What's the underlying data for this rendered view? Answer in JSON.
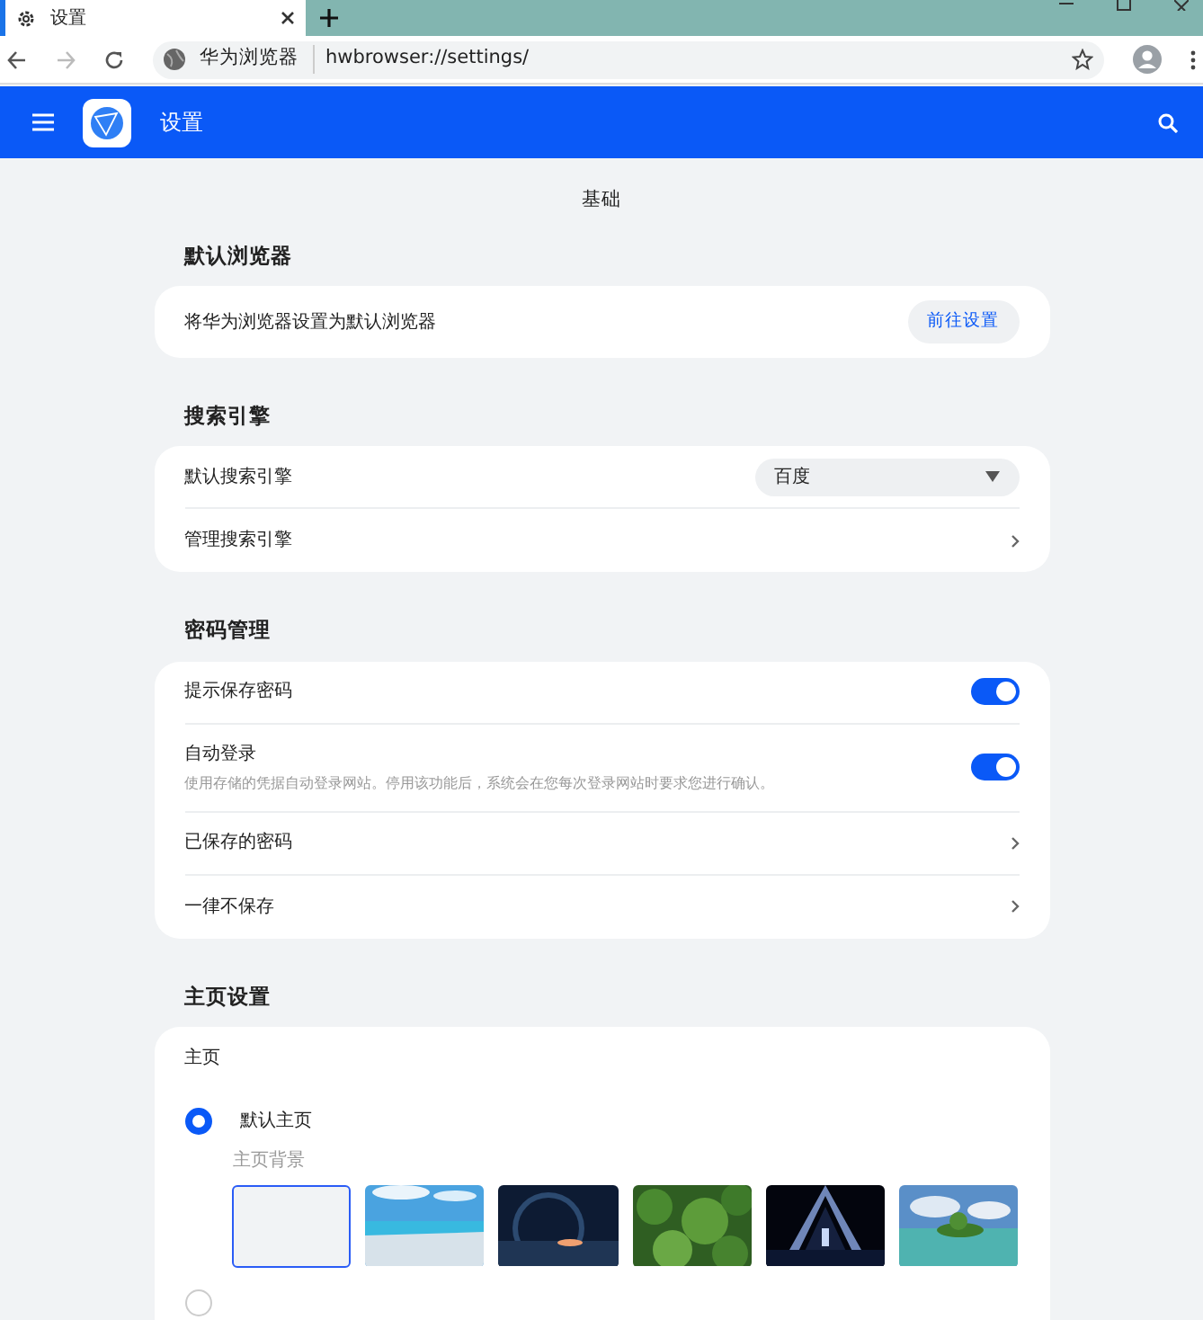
{
  "browser": {
    "tab": {
      "title": "设置"
    },
    "address": {
      "site_label": "华为浏览器",
      "url": "hwbrowser://settings/"
    }
  },
  "header": {
    "title": "设置"
  },
  "page_title": "基础",
  "sections": [
    {
      "title": "默认浏览器",
      "rows": [
        {
          "kind": "button",
          "label": "将华为浏览器设置为默认浏览器",
          "button": "前往设置"
        }
      ]
    },
    {
      "title": "搜索引擎",
      "rows": [
        {
          "kind": "select",
          "label": "默认搜索引擎",
          "value": "百度"
        },
        {
          "kind": "link",
          "label": "管理搜索引擎"
        }
      ]
    },
    {
      "title": "密码管理",
      "rows": [
        {
          "kind": "toggle",
          "label": "提示保存密码",
          "on": true
        },
        {
          "kind": "toggle",
          "label": "自动登录",
          "description": "使用存储的凭据自动登录网站。停用该功能后，系统会在您每次登录网站时要求您进行确认。",
          "on": true
        },
        {
          "kind": "link",
          "label": "已保存的密码"
        },
        {
          "kind": "link",
          "label": "一律不保存"
        }
      ]
    }
  ],
  "homepage": {
    "title": "主页设置",
    "subtitle": "主页",
    "options": [
      {
        "label": "默认主页",
        "selected": true,
        "background_label": "主页背景",
        "backgrounds": [
          {
            "kind": "blank",
            "selected": true
          },
          {
            "kind": "picture",
            "selected": false
          },
          {
            "kind": "picture",
            "selected": false
          },
          {
            "kind": "picture",
            "selected": false
          },
          {
            "kind": "picture",
            "selected": false
          },
          {
            "kind": "picture",
            "selected": false
          }
        ]
      },
      {
        "selected": false
      }
    ]
  }
}
